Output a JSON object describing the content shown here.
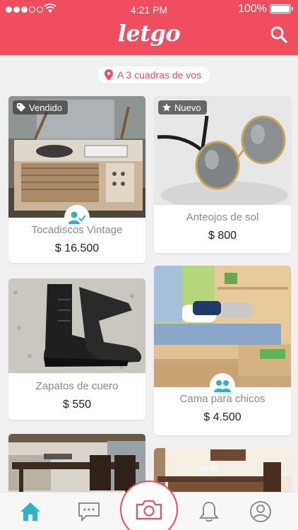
{
  "status_bar": {
    "time": "4:21 PM",
    "battery": "100%"
  },
  "header": {
    "logo": "letgo"
  },
  "location": {
    "label": "A 3 cuadras de vos"
  },
  "products": [
    {
      "title": "Tocadiscos Vintage",
      "price": "$ 16.500",
      "badge": "Vendido",
      "badge_icon": "tag-icon",
      "seller_icon": "verified-user-icon"
    },
    {
      "title": "Anteojos de sol",
      "price": "$ 800",
      "badge": "Nuevo",
      "badge_icon": "star-icon"
    },
    {
      "title": "Zapatos de cuero",
      "price": "$ 550"
    },
    {
      "title": "Cama para chicos",
      "price": "$ 4.500",
      "seller_icon": "users-icon"
    },
    {
      "title": "",
      "price": ""
    },
    {
      "title": "",
      "price": ""
    }
  ],
  "tabs": [
    {
      "name": "home-icon",
      "active": true
    },
    {
      "name": "chat-icon",
      "active": false
    },
    {
      "name": "camera-icon",
      "active": false
    },
    {
      "name": "bell-icon",
      "active": false
    },
    {
      "name": "profile-icon",
      "active": false
    }
  ],
  "colors": {
    "brand": "#f04d5e",
    "tab_active": "#2bb5c0",
    "tab_inactive": "#8c8c8c"
  }
}
